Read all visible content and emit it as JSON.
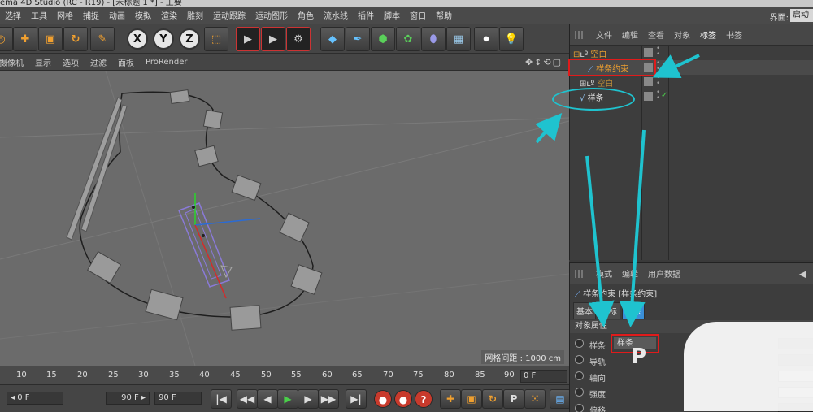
{
  "titlebar": {
    "text": "ema 4D Studio (RC - R19) - [未标题 1 *] - 主要"
  },
  "menubar": {
    "items": [
      "选择",
      "工具",
      "网格",
      "捕捉",
      "动画",
      "模拟",
      "渲染",
      "雕刻",
      "运动跟踪",
      "运动图形",
      "角色",
      "流水线",
      "插件",
      "脚本",
      "窗口",
      "帮助"
    ],
    "layout_label": "界面:",
    "layout_value": "启动"
  },
  "toolbar": {
    "axis_x": "X",
    "axis_y": "Y",
    "axis_z": "Z"
  },
  "viewport": {
    "menu": [
      "摄像机",
      "显示",
      "选项",
      "过滤",
      "面板",
      "ProRender"
    ],
    "nav_icons": "✥↕⟲▢",
    "grid_spacing": "网格间距 : 1000 cm"
  },
  "timeline": {
    "ticks": [
      "10",
      "15",
      "20",
      "25",
      "30",
      "35",
      "40",
      "45",
      "50",
      "55",
      "60",
      "65",
      "70",
      "75",
      "80",
      "85",
      "90"
    ],
    "current_frame": "0 F"
  },
  "transport": {
    "start_field": "◂ 0 F",
    "end_field": "90 F ▸",
    "max_field": "90 F"
  },
  "object_manager": {
    "menu": [
      "文件",
      "编辑",
      "查看",
      "对象",
      "标签",
      "书签"
    ],
    "rows": [
      {
        "name": "空白"
      },
      {
        "name": "样条约束"
      },
      {
        "name": "空白"
      },
      {
        "name": "样条"
      }
    ]
  },
  "attribute_manager": {
    "menu": [
      "模式",
      "编辑",
      "用户数据"
    ],
    "title": "样条约束 [样条约束]",
    "tabs": [
      "基本",
      "坐标",
      "对象"
    ],
    "section": "对象属性",
    "props": [
      {
        "label": "样条",
        "value": "样条"
      },
      {
        "label": "导轨"
      },
      {
        "label": "轴向"
      },
      {
        "label": "强度"
      },
      {
        "label": "偏移"
      }
    ],
    "watermark": "P"
  },
  "colors": {
    "highlight_red": "#e01b1b",
    "annotation_cyan": "#1fc3cf",
    "active_tab": "#3a8fd8"
  }
}
